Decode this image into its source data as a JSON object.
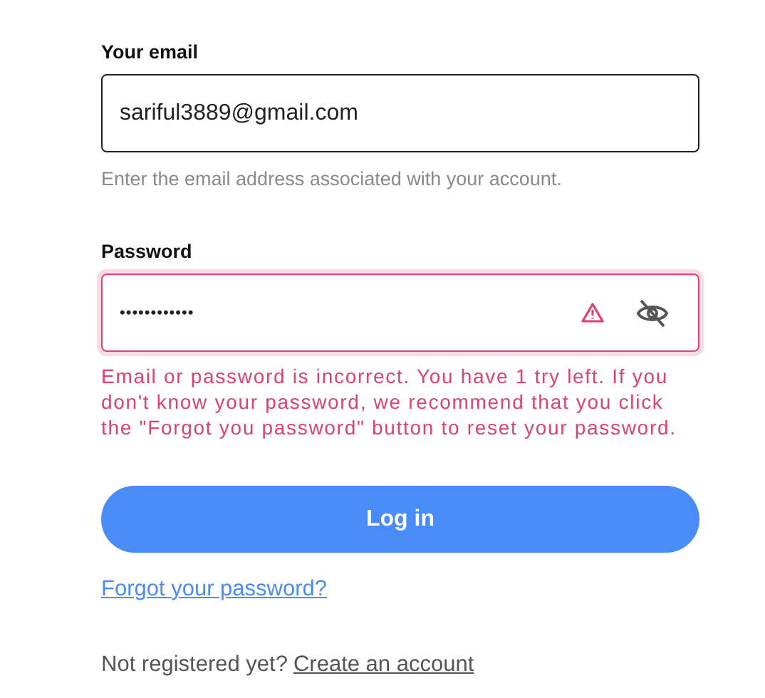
{
  "email": {
    "label": "Your email",
    "value": "sariful3889@gmail.com",
    "hint": "Enter the email address associated with your account.",
    "error": false
  },
  "password": {
    "label": "Password",
    "value": "••••••••••••",
    "error": true,
    "visible": false,
    "message": "Email or password is incorrect. You have 1 try left. If you don't know your password, we recommend that you click the \"Forgot you password\" button to reset your password."
  },
  "login_button": "Log in",
  "forgot_link": "Forgot your password?",
  "register": {
    "prompt": "Not registered yet?",
    "link": "Create an account"
  }
}
